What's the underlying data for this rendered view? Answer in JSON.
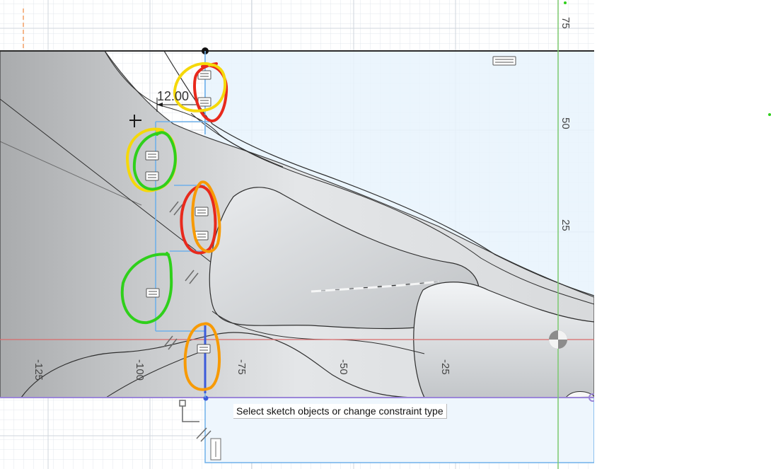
{
  "tooltip": {
    "text": "Select sketch objects or change constraint type"
  },
  "axis_labels": {
    "horizontal": [
      "-125",
      "-100",
      "-75",
      "-50",
      "-25"
    ],
    "vertical": [
      "75",
      "50",
      "25"
    ]
  },
  "dimension": {
    "value": "12.00"
  },
  "colors": {
    "grid_minor": "#dfe3e8",
    "grid_major": "#c8ced6",
    "selection": "#6fb0ea",
    "body_fill": "#cfd2d6",
    "x_axis": "#d96b6b",
    "y_axis": "#7bc96f",
    "constraint_line": "#3b5bdb",
    "profile_edge": "#9b86d8",
    "annotation_red": "#e8291c",
    "annotation_yellow": "#f5d80a",
    "annotation_green": "#2fd01b",
    "annotation_orange": "#f79a05"
  },
  "icons": [
    "horizontal-constraint-icon",
    "parallel-constraint-icon",
    "origin-icon",
    "fixed-constraint-icon",
    "coincident-point-icon"
  ]
}
